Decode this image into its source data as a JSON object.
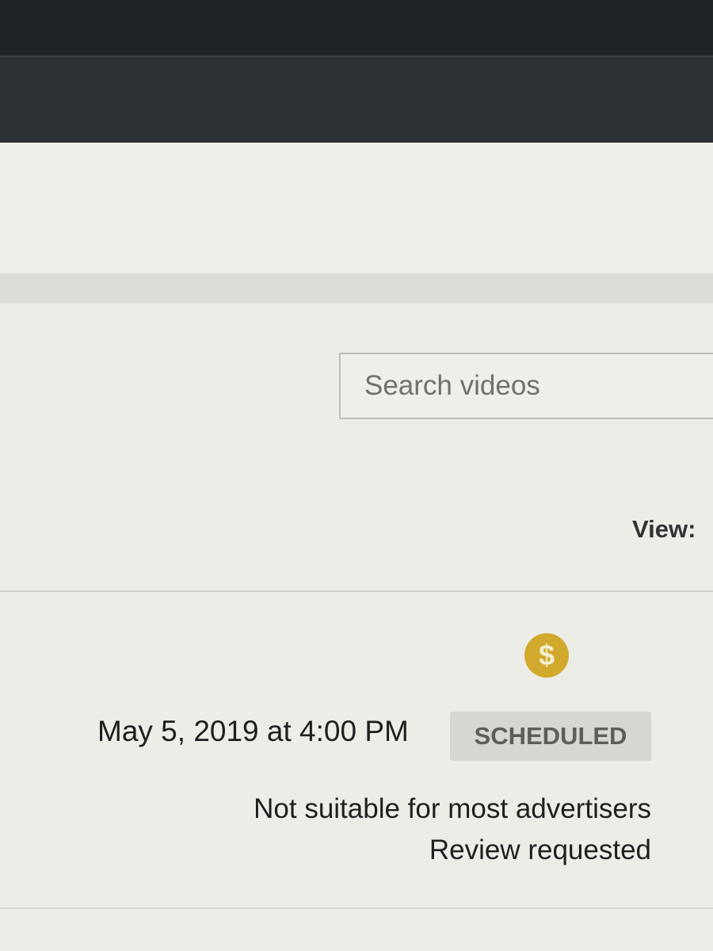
{
  "search": {
    "placeholder": "Search videos"
  },
  "toolbar": {
    "view_label": "View:"
  },
  "video_row": {
    "monetization_icon": "dollar-sign-icon",
    "monetization_glyph": "$",
    "monetization_color": "#d1a92c",
    "publish_date": "May 5, 2019 at 4:00 PM",
    "status": "SCHEDULED",
    "ad_suitability": "Not suitable for most advertisers",
    "review_status": "Review requested"
  }
}
